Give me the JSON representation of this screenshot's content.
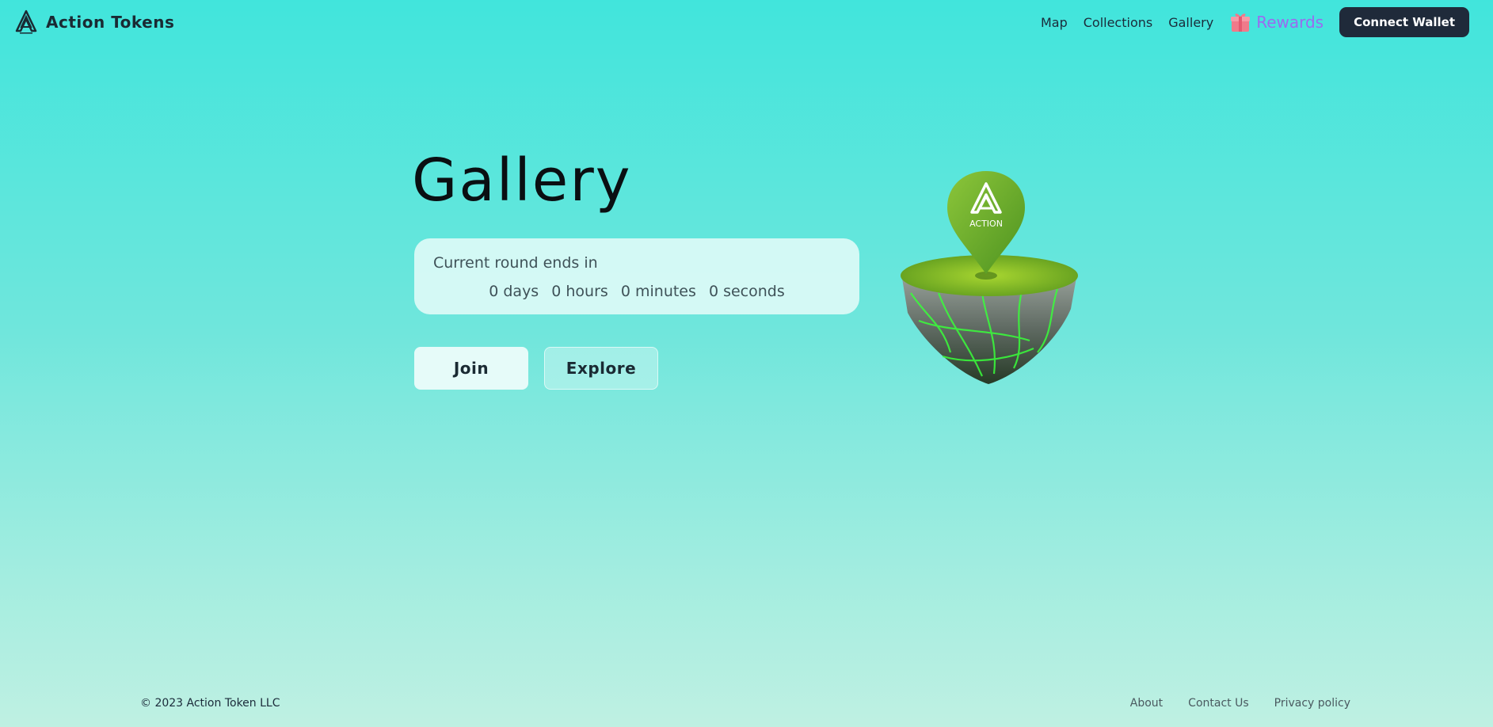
{
  "brand": {
    "name": "Action Tokens",
    "logo_icon": "action-logo-icon"
  },
  "nav": {
    "links": [
      "Map",
      "Collections",
      "Gallery"
    ],
    "rewards_label": "Rewards",
    "rewards_icon": "gift-icon",
    "connect_label": "Connect Wallet"
  },
  "hero": {
    "title": "Gallery",
    "round_label": "Current round ends in",
    "countdown": {
      "days": "0 days",
      "hours": "0 hours",
      "minutes": "0 minutes",
      "seconds": "0 seconds"
    },
    "join_label": "Join",
    "explore_label": "Explore",
    "illustration": "floating-island-map-pin-icon",
    "pin_text": "ACTION"
  },
  "footer": {
    "copyright": "© 2023 Action Token LLC",
    "links": [
      "About",
      "Contact Us",
      "Privacy policy"
    ]
  },
  "colors": {
    "bg_top": "#41e5dc",
    "bg_bottom": "#bff0e2",
    "button_dark": "#1f2a3a",
    "rewards_purple": "#9a6bf0",
    "card": "#e8fbf9"
  }
}
